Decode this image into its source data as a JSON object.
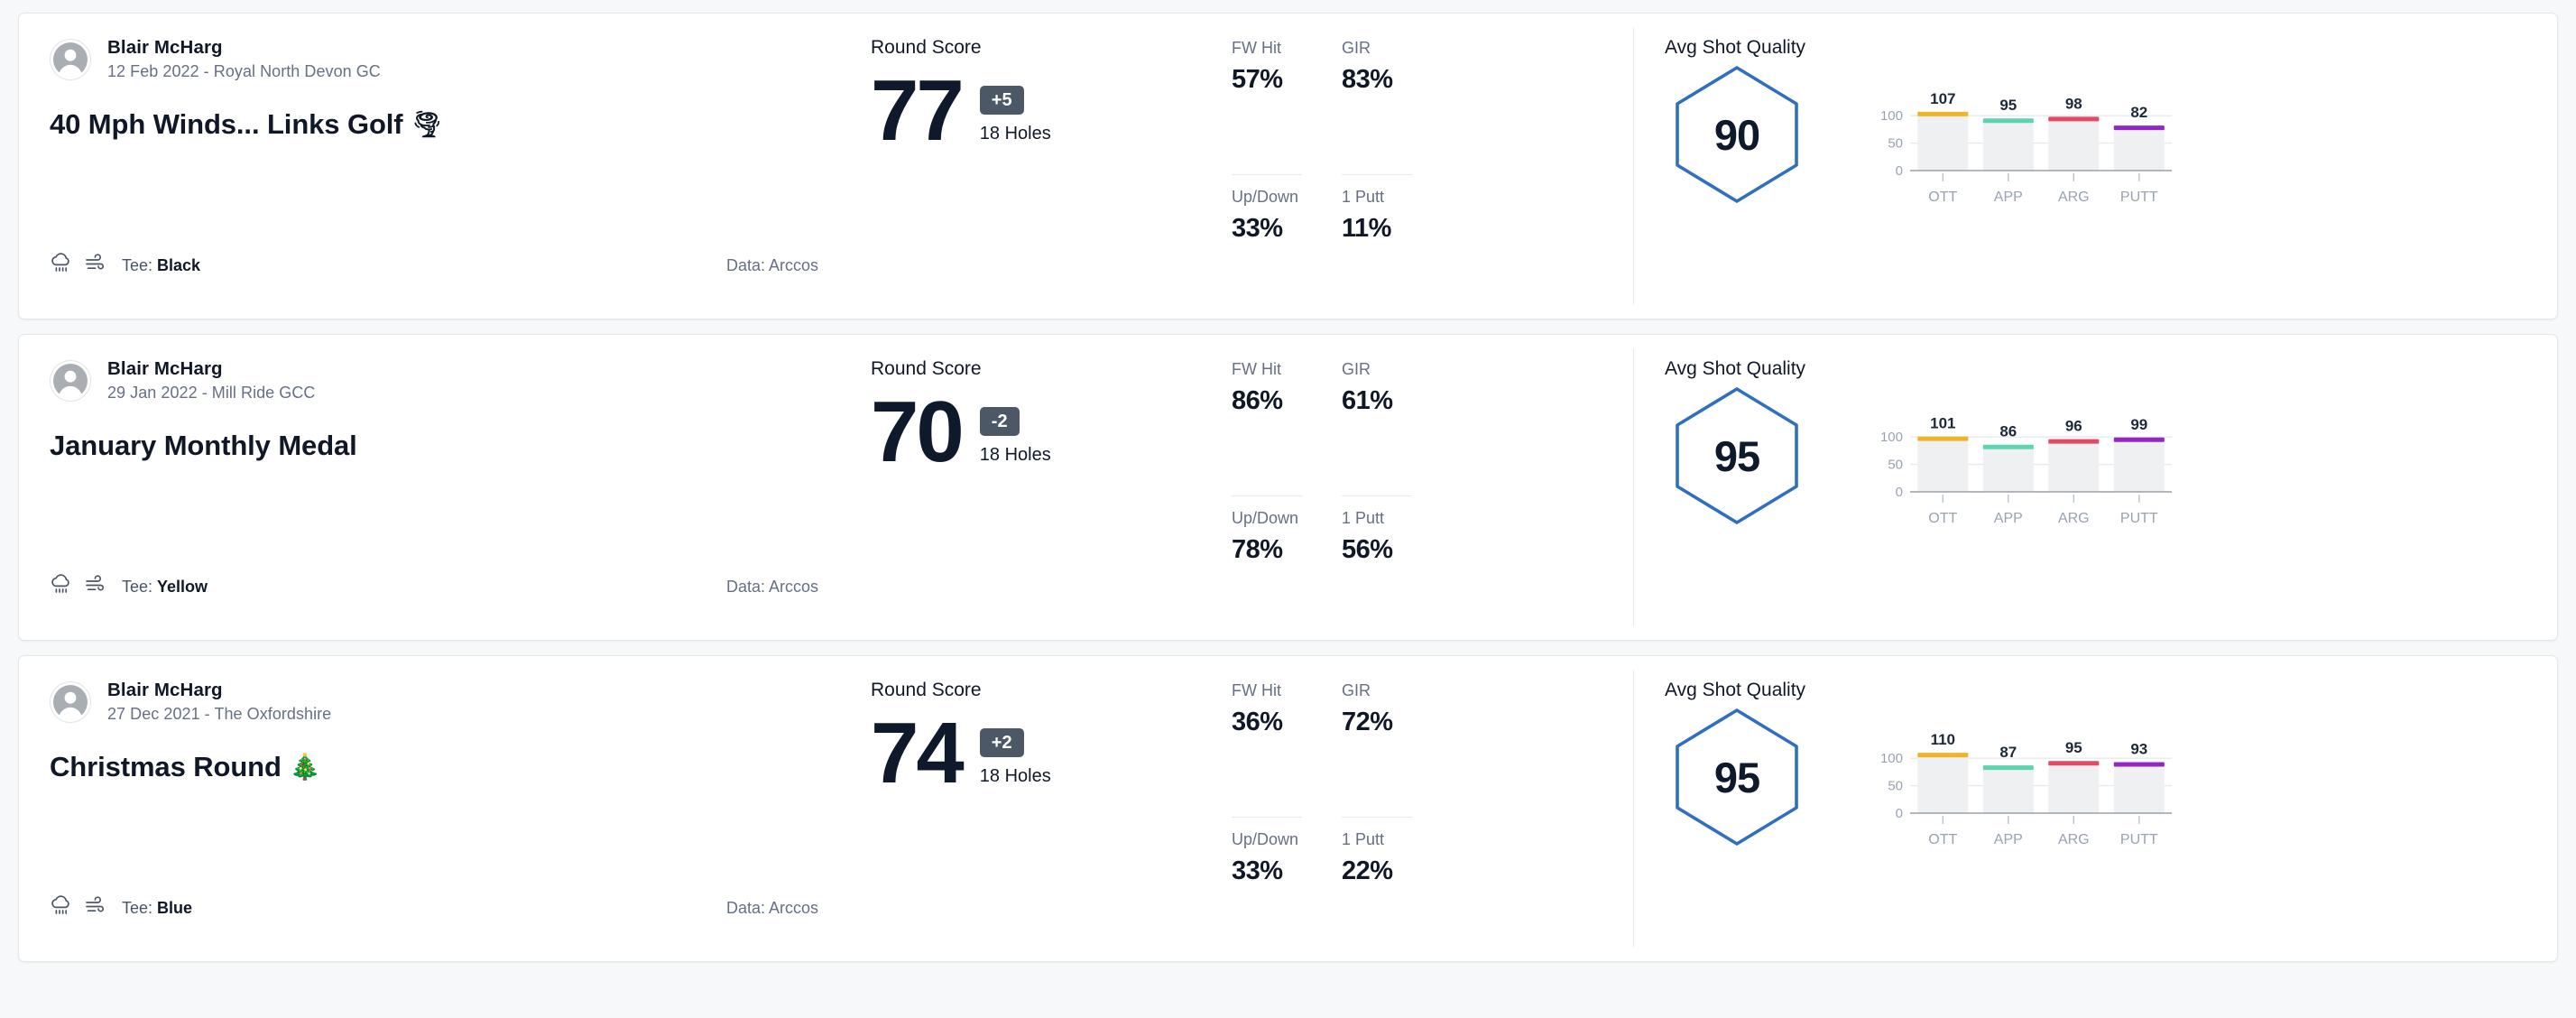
{
  "colors": {
    "accent_blue": "#2f6fc0",
    "ott": "#f0b429",
    "app": "#5ed3b0",
    "arg": "#e34a64",
    "putt": "#9327c4",
    "bar_bg": "#eef0f1",
    "score_diff_bg": "#4d5866"
  },
  "chart_axis": {
    "y_ticks": [
      "100",
      "50",
      "0"
    ],
    "categories": [
      "OTT",
      "APP",
      "ARG",
      "PUTT"
    ],
    "ylim_max": 125
  },
  "labels": {
    "round_score": "Round Score",
    "holes": "18 Holes",
    "avg_shot_quality": "Avg Shot Quality",
    "tee_prefix": "Tee: ",
    "stat_fw": "FW Hit",
    "stat_gir": "GIR",
    "stat_updown": "Up/Down",
    "stat_1putt": "1 Putt"
  },
  "rounds": [
    {
      "user": "Blair McHarg",
      "subtitle": "12 Feb 2022 - Royal North Devon GC",
      "title": "40 Mph Winds... Links Golf",
      "title_emoji": "🌪",
      "tee": "Black",
      "data_source": "Data: Arccos",
      "score": "77",
      "score_diff": "+5",
      "holes": "18 Holes",
      "stats": {
        "fw_hit": "57%",
        "gir": "83%",
        "up_down": "33%",
        "one_putt": "11%"
      },
      "avg_shot_quality": "90",
      "chart_data": {
        "type": "bar",
        "title": "Avg Shot Quality",
        "categories": [
          "OTT",
          "APP",
          "ARG",
          "PUTT"
        ],
        "values": [
          107,
          95,
          98,
          82
        ],
        "colors": [
          "#f0b429",
          "#5ed3b0",
          "#e34a64",
          "#9327c4"
        ],
        "ylabel": "",
        "xlabel": "",
        "ylim": [
          0,
          125
        ],
        "yticks": [
          0,
          50,
          100
        ],
        "grid": true,
        "legend": "none"
      }
    },
    {
      "user": "Blair McHarg",
      "subtitle": "29 Jan 2022 - Mill Ride GCC",
      "title": "January Monthly Medal",
      "title_emoji": "",
      "tee": "Yellow",
      "data_source": "Data: Arccos",
      "score": "70",
      "score_diff": "-2",
      "holes": "18 Holes",
      "stats": {
        "fw_hit": "86%",
        "gir": "61%",
        "up_down": "78%",
        "one_putt": "56%"
      },
      "avg_shot_quality": "95",
      "chart_data": {
        "type": "bar",
        "title": "Avg Shot Quality",
        "categories": [
          "OTT",
          "APP",
          "ARG",
          "PUTT"
        ],
        "values": [
          101,
          86,
          96,
          99
        ],
        "colors": [
          "#f0b429",
          "#5ed3b0",
          "#e34a64",
          "#9327c4"
        ],
        "ylabel": "",
        "xlabel": "",
        "ylim": [
          0,
          125
        ],
        "yticks": [
          0,
          50,
          100
        ],
        "grid": true,
        "legend": "none"
      }
    },
    {
      "user": "Blair McHarg",
      "subtitle": "27 Dec 2021 - The Oxfordshire",
      "title": "Christmas Round",
      "title_emoji": "🎄",
      "tee": "Blue",
      "data_source": "Data: Arccos",
      "score": "74",
      "score_diff": "+2",
      "holes": "18 Holes",
      "stats": {
        "fw_hit": "36%",
        "gir": "72%",
        "up_down": "33%",
        "one_putt": "22%"
      },
      "avg_shot_quality": "95",
      "chart_data": {
        "type": "bar",
        "title": "Avg Shot Quality",
        "categories": [
          "OTT",
          "APP",
          "ARG",
          "PUTT"
        ],
        "values": [
          110,
          87,
          95,
          93
        ],
        "colors": [
          "#f0b429",
          "#5ed3b0",
          "#e34a64",
          "#9327c4"
        ],
        "ylabel": "",
        "xlabel": "",
        "ylim": [
          0,
          125
        ],
        "yticks": [
          0,
          50,
          100
        ],
        "grid": true,
        "legend": "none"
      }
    }
  ]
}
